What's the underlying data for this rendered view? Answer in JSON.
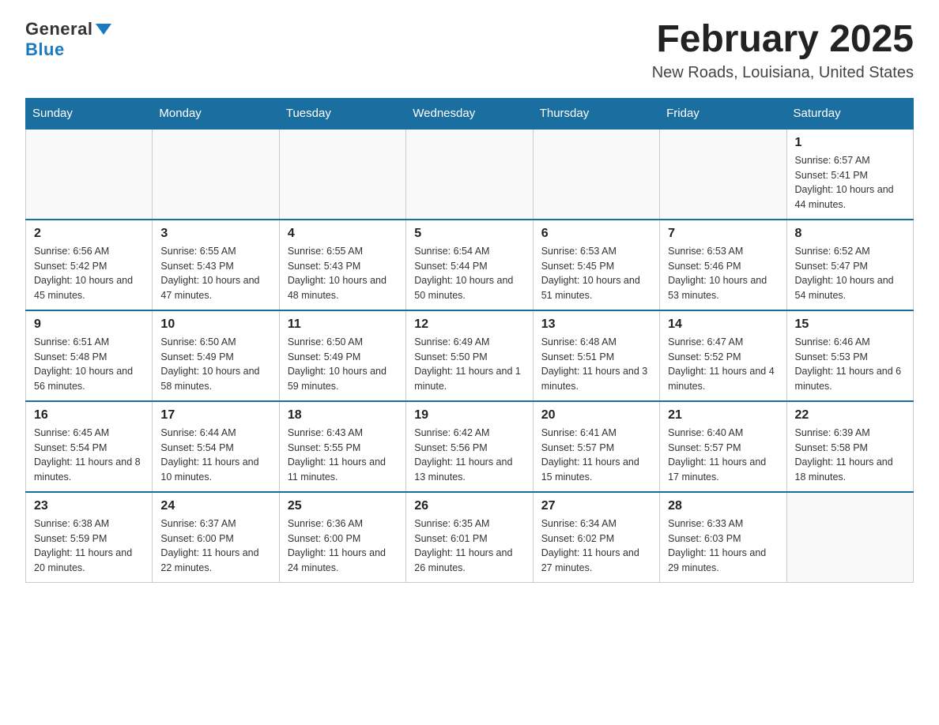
{
  "header": {
    "logo_general": "General",
    "logo_blue": "Blue",
    "month_title": "February 2025",
    "location": "New Roads, Louisiana, United States"
  },
  "days_of_week": [
    "Sunday",
    "Monday",
    "Tuesday",
    "Wednesday",
    "Thursday",
    "Friday",
    "Saturday"
  ],
  "weeks": [
    [
      {
        "day": "",
        "sunrise": "",
        "sunset": "",
        "daylight": ""
      },
      {
        "day": "",
        "sunrise": "",
        "sunset": "",
        "daylight": ""
      },
      {
        "day": "",
        "sunrise": "",
        "sunset": "",
        "daylight": ""
      },
      {
        "day": "",
        "sunrise": "",
        "sunset": "",
        "daylight": ""
      },
      {
        "day": "",
        "sunrise": "",
        "sunset": "",
        "daylight": ""
      },
      {
        "day": "",
        "sunrise": "",
        "sunset": "",
        "daylight": ""
      },
      {
        "day": "1",
        "sunrise": "Sunrise: 6:57 AM",
        "sunset": "Sunset: 5:41 PM",
        "daylight": "Daylight: 10 hours and 44 minutes."
      }
    ],
    [
      {
        "day": "2",
        "sunrise": "Sunrise: 6:56 AM",
        "sunset": "Sunset: 5:42 PM",
        "daylight": "Daylight: 10 hours and 45 minutes."
      },
      {
        "day": "3",
        "sunrise": "Sunrise: 6:55 AM",
        "sunset": "Sunset: 5:43 PM",
        "daylight": "Daylight: 10 hours and 47 minutes."
      },
      {
        "day": "4",
        "sunrise": "Sunrise: 6:55 AM",
        "sunset": "Sunset: 5:43 PM",
        "daylight": "Daylight: 10 hours and 48 minutes."
      },
      {
        "day": "5",
        "sunrise": "Sunrise: 6:54 AM",
        "sunset": "Sunset: 5:44 PM",
        "daylight": "Daylight: 10 hours and 50 minutes."
      },
      {
        "day": "6",
        "sunrise": "Sunrise: 6:53 AM",
        "sunset": "Sunset: 5:45 PM",
        "daylight": "Daylight: 10 hours and 51 minutes."
      },
      {
        "day": "7",
        "sunrise": "Sunrise: 6:53 AM",
        "sunset": "Sunset: 5:46 PM",
        "daylight": "Daylight: 10 hours and 53 minutes."
      },
      {
        "day": "8",
        "sunrise": "Sunrise: 6:52 AM",
        "sunset": "Sunset: 5:47 PM",
        "daylight": "Daylight: 10 hours and 54 minutes."
      }
    ],
    [
      {
        "day": "9",
        "sunrise": "Sunrise: 6:51 AM",
        "sunset": "Sunset: 5:48 PM",
        "daylight": "Daylight: 10 hours and 56 minutes."
      },
      {
        "day": "10",
        "sunrise": "Sunrise: 6:50 AM",
        "sunset": "Sunset: 5:49 PM",
        "daylight": "Daylight: 10 hours and 58 minutes."
      },
      {
        "day": "11",
        "sunrise": "Sunrise: 6:50 AM",
        "sunset": "Sunset: 5:49 PM",
        "daylight": "Daylight: 10 hours and 59 minutes."
      },
      {
        "day": "12",
        "sunrise": "Sunrise: 6:49 AM",
        "sunset": "Sunset: 5:50 PM",
        "daylight": "Daylight: 11 hours and 1 minute."
      },
      {
        "day": "13",
        "sunrise": "Sunrise: 6:48 AM",
        "sunset": "Sunset: 5:51 PM",
        "daylight": "Daylight: 11 hours and 3 minutes."
      },
      {
        "day": "14",
        "sunrise": "Sunrise: 6:47 AM",
        "sunset": "Sunset: 5:52 PM",
        "daylight": "Daylight: 11 hours and 4 minutes."
      },
      {
        "day": "15",
        "sunrise": "Sunrise: 6:46 AM",
        "sunset": "Sunset: 5:53 PM",
        "daylight": "Daylight: 11 hours and 6 minutes."
      }
    ],
    [
      {
        "day": "16",
        "sunrise": "Sunrise: 6:45 AM",
        "sunset": "Sunset: 5:54 PM",
        "daylight": "Daylight: 11 hours and 8 minutes."
      },
      {
        "day": "17",
        "sunrise": "Sunrise: 6:44 AM",
        "sunset": "Sunset: 5:54 PM",
        "daylight": "Daylight: 11 hours and 10 minutes."
      },
      {
        "day": "18",
        "sunrise": "Sunrise: 6:43 AM",
        "sunset": "Sunset: 5:55 PM",
        "daylight": "Daylight: 11 hours and 11 minutes."
      },
      {
        "day": "19",
        "sunrise": "Sunrise: 6:42 AM",
        "sunset": "Sunset: 5:56 PM",
        "daylight": "Daylight: 11 hours and 13 minutes."
      },
      {
        "day": "20",
        "sunrise": "Sunrise: 6:41 AM",
        "sunset": "Sunset: 5:57 PM",
        "daylight": "Daylight: 11 hours and 15 minutes."
      },
      {
        "day": "21",
        "sunrise": "Sunrise: 6:40 AM",
        "sunset": "Sunset: 5:57 PM",
        "daylight": "Daylight: 11 hours and 17 minutes."
      },
      {
        "day": "22",
        "sunrise": "Sunrise: 6:39 AM",
        "sunset": "Sunset: 5:58 PM",
        "daylight": "Daylight: 11 hours and 18 minutes."
      }
    ],
    [
      {
        "day": "23",
        "sunrise": "Sunrise: 6:38 AM",
        "sunset": "Sunset: 5:59 PM",
        "daylight": "Daylight: 11 hours and 20 minutes."
      },
      {
        "day": "24",
        "sunrise": "Sunrise: 6:37 AM",
        "sunset": "Sunset: 6:00 PM",
        "daylight": "Daylight: 11 hours and 22 minutes."
      },
      {
        "day": "25",
        "sunrise": "Sunrise: 6:36 AM",
        "sunset": "Sunset: 6:00 PM",
        "daylight": "Daylight: 11 hours and 24 minutes."
      },
      {
        "day": "26",
        "sunrise": "Sunrise: 6:35 AM",
        "sunset": "Sunset: 6:01 PM",
        "daylight": "Daylight: 11 hours and 26 minutes."
      },
      {
        "day": "27",
        "sunrise": "Sunrise: 6:34 AM",
        "sunset": "Sunset: 6:02 PM",
        "daylight": "Daylight: 11 hours and 27 minutes."
      },
      {
        "day": "28",
        "sunrise": "Sunrise: 6:33 AM",
        "sunset": "Sunset: 6:03 PM",
        "daylight": "Daylight: 11 hours and 29 minutes."
      },
      {
        "day": "",
        "sunrise": "",
        "sunset": "",
        "daylight": ""
      }
    ]
  ]
}
